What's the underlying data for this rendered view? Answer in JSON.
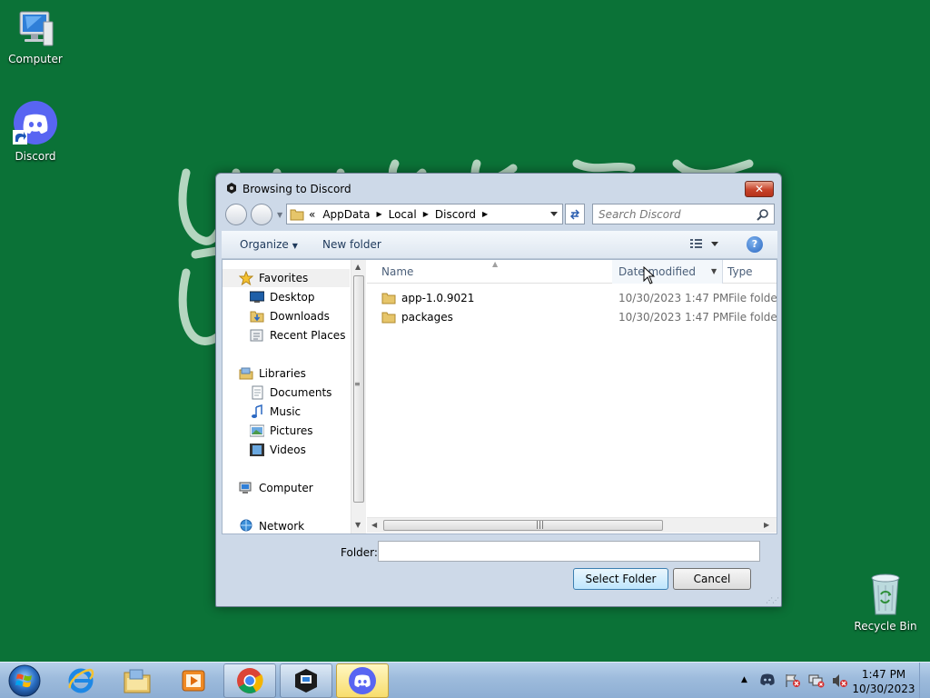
{
  "desktop": {
    "icons": [
      {
        "label": "Computer"
      },
      {
        "label": "Discord"
      },
      {
        "label": "Recycle Bin"
      }
    ]
  },
  "dialog": {
    "title": "Browsing to Discord",
    "close_label": "✕",
    "breadcrumb": [
      "«",
      "AppData",
      "Local",
      "Discord"
    ],
    "search_placeholder": "Search Discord",
    "toolbar": {
      "organize_label": "Organize",
      "new_folder_label": "New folder",
      "help_label": "?"
    },
    "nav_pane": {
      "favorites": {
        "label": "Favorites",
        "items": [
          "Desktop",
          "Downloads",
          "Recent Places"
        ]
      },
      "libraries": {
        "label": "Libraries",
        "items": [
          "Documents",
          "Music",
          "Pictures",
          "Videos"
        ]
      },
      "computer_label": "Computer",
      "network_label": "Network"
    },
    "columns": {
      "name": "Name",
      "date_modified": "Date modified",
      "type": "Type"
    },
    "files": [
      {
        "name": "app-1.0.9021",
        "date": "10/30/2023 1:47 PM",
        "type": "File folder"
      },
      {
        "name": "packages",
        "date": "10/30/2023 1:47 PM",
        "type": "File folder"
      }
    ],
    "folder_label": "Folder:",
    "folder_value": "",
    "select_folder_label": "Select Folder",
    "cancel_label": "Cancel"
  },
  "taskbar": {
    "apps": [
      "internet-explorer",
      "file-explorer",
      "media-player",
      "chrome",
      "app-installer",
      "discord"
    ],
    "clock": {
      "time": "1:47 PM",
      "date": "10/30/2023"
    }
  },
  "colors": {
    "desktop_bg": "#0b7237",
    "discord_blurple": "#5865f2"
  }
}
